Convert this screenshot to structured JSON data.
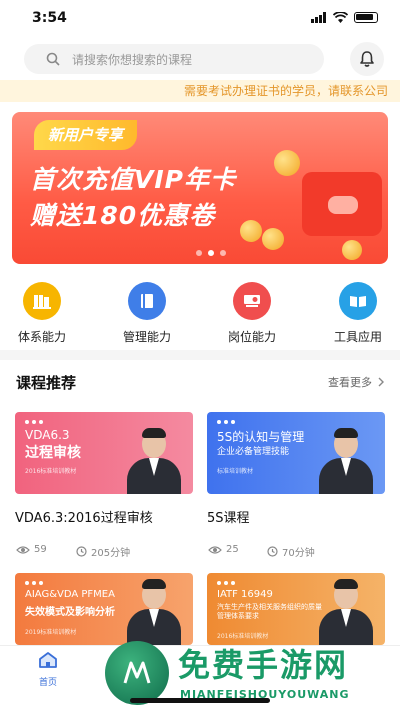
{
  "status_bar": {
    "time": "3:54"
  },
  "search": {
    "placeholder": "请搜索你想搜索的课程"
  },
  "notice": {
    "text": "需要考试办理证书的学员，请联系公司"
  },
  "banner": {
    "tag": "新用户专享",
    "line1": "首次充值VIP年卡",
    "line2": "赠送180优惠卷",
    "dots_total": 3,
    "active_dot": 2
  },
  "categories": [
    {
      "label": "体系能力",
      "icon": "book-stack-icon",
      "color": "#f7b500"
    },
    {
      "label": "管理能力",
      "icon": "book-icon",
      "color": "#3f7ee8"
    },
    {
      "label": "岗位能力",
      "icon": "projector-icon",
      "color": "#f04e4e"
    },
    {
      "label": "工具应用",
      "icon": "open-book-icon",
      "color": "#27a1e6"
    }
  ],
  "section": {
    "title": "课程推荐",
    "more": "查看更多"
  },
  "courses": [
    {
      "img_title1": "VDA6.3",
      "img_title2": "过程审核",
      "img_small": "2016标准培训教材",
      "name": "VDA6.3:2016过程审核",
      "views": "59",
      "duration": "205分钟",
      "bg": "#f06a82"
    },
    {
      "img_title1": "5S的认知与管理",
      "img_title2": "企业必备管理技能",
      "img_small": "标准培训教材",
      "name": "5S课程",
      "views": "25",
      "duration": "70分钟",
      "bg": "#4c7ff0"
    },
    {
      "img_title1": "AIAG&VDA PFMEA",
      "img_title2": "失效模式及影响分析",
      "img_small": "2019标准培训教材",
      "bg": "#f4894c"
    },
    {
      "img_title1": "IATF 16949",
      "img_title2": "汽车生产件及相关服务组织的质量管理体系要求",
      "img_small": "2016标准培训教材",
      "bg": "#f29a3c"
    }
  ],
  "tabbar": {
    "home": "首页"
  },
  "watermark": {
    "title": "免费手游网",
    "sub": "MIANFEISHOUYOUWANG"
  }
}
